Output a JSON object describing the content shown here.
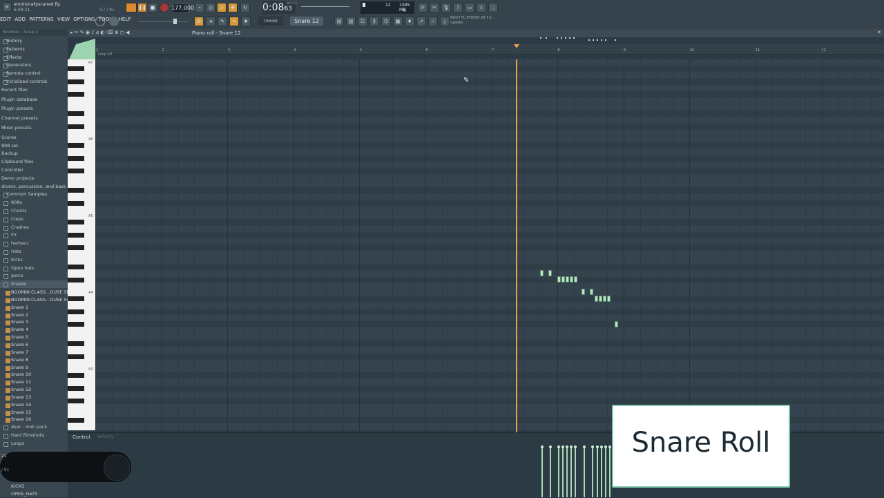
{
  "title": {
    "file": "emotionallyscarred.flp",
    "time": "6:09:21",
    "hint": "G7 / 91"
  },
  "menu": [
    "EDIT",
    "ADD",
    "PATTERNS",
    "VIEW",
    "OPTIONS",
    "TOOLS",
    "HELP"
  ],
  "transport": {
    "bpm": "177.000",
    "clock_main": "0:08",
    "clock_sub": "63",
    "clock_unit": "M:S:CS"
  },
  "cpu": {
    "voices": "12",
    "memory": "1095 MB",
    "zero": "0"
  },
  "pattern": {
    "none": "(none)",
    "current": "Snare 12"
  },
  "news": {
    "line1": "06/27  FL STUDIO 20.7.1",
    "line2": "Update"
  },
  "browser": {
    "header": "Browser - Snap 4",
    "top_items": [
      "History",
      "Patterns",
      "Effects",
      "Generators",
      "Remote control",
      "Initialized controls"
    ],
    "root_items": [
      "Recent files",
      "Plugin database",
      "Plugin presets",
      "Channel presets",
      "Mixer presets",
      "Scores",
      "808 set",
      "Backup",
      "Clipboard files",
      "Controller",
      "Demo projects",
      "drums, percussion, and bass"
    ],
    "common_samples": "Common Samples",
    "folders": [
      "808s",
      "Chants",
      "Claps",
      "Crashes",
      "FX",
      "harbacc",
      "Hats",
      "Kicks",
      "Open hats",
      "percs",
      "Snares"
    ],
    "files": [
      "BOOMIN CLASS...OUSE SNARE 1",
      "BOOMIN CLASS...OUSE SNARE 2",
      "Snare 1",
      "Snare 2",
      "Snare 3",
      "Snare 4",
      "Snare 5",
      "Snare 6",
      "Snare 7",
      "Snare 8",
      "Snare 9",
      "Snare 10",
      "Snare 11",
      "Snare 12",
      "Snare 13",
      "Snare 14",
      "Snare 15",
      "Snare 16"
    ],
    "after": [
      "dset - midi pack",
      "Hard Rimshots",
      "Loops"
    ],
    "bottom": [
      "KICKS",
      "OPEN_HATS"
    ]
  },
  "piano_roll": {
    "title": "Piano roll - Snare 12",
    "bars": [
      "1",
      "2",
      "3",
      "4",
      "5",
      "6",
      "7",
      "8",
      "9",
      "10",
      "11",
      "12"
    ],
    "loop_label": "Loop off",
    "key_labels": [
      "A7",
      "A6",
      "A5",
      "A4",
      "A3"
    ],
    "notes_fraction": "Snare roll notes around bar 8-9"
  },
  "control": {
    "label": "Control",
    "sub": "Velocity"
  },
  "overlay": {
    "caption": "Snare Roll"
  },
  "pill": {
    "top": "21",
    "bottom": "/ 91"
  },
  "colors": {
    "playhead": "#e8a246",
    "note": "#b9e6c4",
    "accent": "#7fc8b0"
  }
}
